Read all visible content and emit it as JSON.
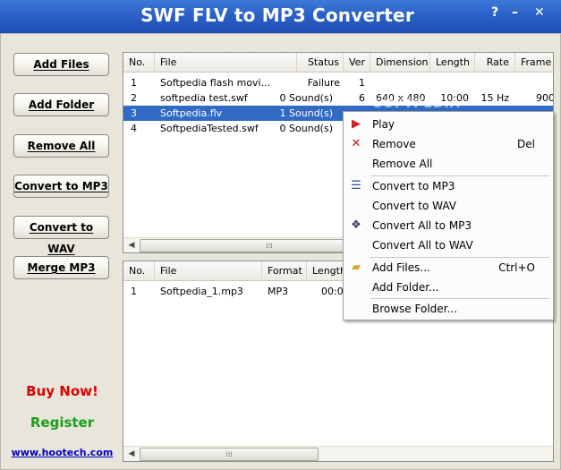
{
  "window": {
    "title": "SWF FLV to MP3 Converter",
    "help": "?",
    "minimize": "–",
    "close": "✕"
  },
  "buttons": {
    "add_files": "Add Files",
    "add_folder": "Add Folder",
    "remove_all": "Remove All",
    "convert_mp3": "Convert to MP3",
    "convert_wav": "Convert to WAV",
    "merge_mp3": "Merge MP3"
  },
  "promo": {
    "buy": "Buy Now!",
    "register": "Register",
    "url": "www.hootech.com"
  },
  "top_list": {
    "columns": [
      "No.",
      "File",
      "Status",
      "Ver",
      "Dimension",
      "Length",
      "Rate",
      "Frame"
    ],
    "rows": [
      [
        "1",
        "Softpedia flash movi...",
        "Failure",
        "1",
        "",
        "",
        "",
        ""
      ],
      [
        "2",
        "softpedia test.swf",
        "0 Sound(s)",
        "6",
        "640 x 480",
        "10:00",
        "15 Hz",
        "900"
      ],
      [
        "3",
        "Softpedia.flv",
        "1 Sound(s)",
        "",
        "",
        "",
        "",
        ""
      ],
      [
        "4",
        "SoftpediaTested.swf",
        "0 Sound(s)",
        "",
        "",
        "",
        "",
        ""
      ]
    ]
  },
  "bottom_list": {
    "columns": [
      "No.",
      "File",
      "Format",
      "Length"
    ],
    "rows": [
      [
        "1",
        "Softpedia_1.mp3",
        "MP3",
        "00:0"
      ]
    ]
  },
  "watermark": "SOFTPEDIA",
  "context_menu": {
    "play": "Play",
    "remove": "Remove",
    "remove_shortcut": "Del",
    "remove_all": "Remove All",
    "convert_mp3": "Convert to MP3",
    "convert_wav": "Convert to WAV",
    "convert_all_mp3": "Convert All to MP3",
    "convert_all_wav": "Convert All to WAV",
    "add_files": "Add Files...",
    "add_files_shortcut": "Ctrl+O",
    "add_folder": "Add Folder...",
    "browse_folder": "Browse Folder..."
  },
  "colors": {
    "title_bar": "#2c63c9",
    "selection": "#316ac5",
    "buy": "#e00000",
    "register": "#19a019",
    "link": "#0000c0"
  }
}
